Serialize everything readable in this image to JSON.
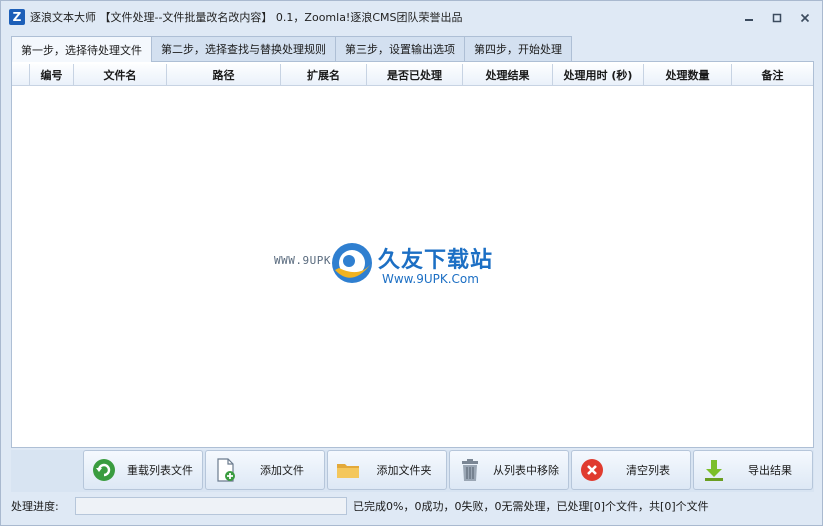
{
  "window": {
    "app_icon_letter": "Z",
    "title": "逐浪文本大师 【文件处理--文件批量改名改内容】 0.1，Zoomla!逐浪CMS团队荣誉出品"
  },
  "tabs": [
    {
      "label": "第一步，选择待处理文件"
    },
    {
      "label": "第二步，选择查找与替换处理规则"
    },
    {
      "label": "第三步，设置输出选项"
    },
    {
      "label": "第四步，开始处理"
    }
  ],
  "grid": {
    "columns": [
      "编号",
      "文件名",
      "路径",
      "扩展名",
      "是否已处理",
      "处理结果",
      "处理用时 (秒)",
      "处理数量",
      "备注"
    ],
    "rows": []
  },
  "watermark": {
    "url_left": "WWW.9UPK.COM",
    "brand": "久友下载站",
    "url": "Www.9UPK.Com"
  },
  "toolbar": {
    "reload": "重载列表文件",
    "add_file": "添加文件",
    "add_folder": "添加文件夹",
    "remove": "从列表中移除",
    "clear": "清空列表",
    "export": "导出结果"
  },
  "status": {
    "label": "处理进度:",
    "progress": 0,
    "summary": "已完成0%，0成功，0失败，0无需处理，已处理[0]个文件，共[0]个文件"
  },
  "colors": {
    "accent": "#1d5fb8",
    "window_bg": "#dfe9f5",
    "watermark_blue": "#1c6fc4"
  }
}
